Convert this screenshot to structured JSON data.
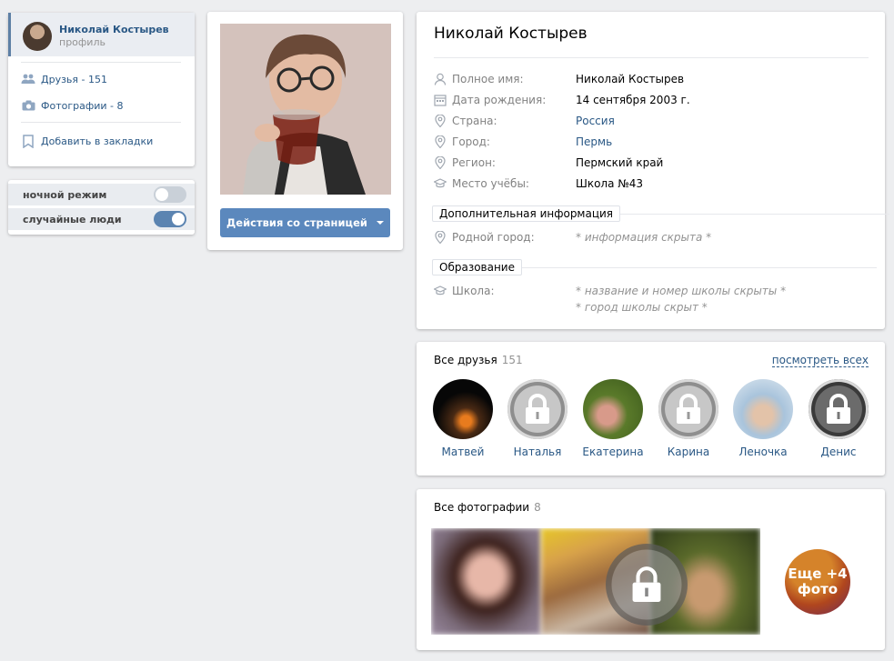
{
  "menu": {
    "profile_name": "Николай Костырев",
    "profile_sub": "профиль",
    "friends": "Друзья - 151",
    "photos": "Фотографии - 8",
    "bookmark": "Добавить в закладки"
  },
  "toggles": {
    "night_mode": {
      "label": "ночной режим",
      "on": false
    },
    "random_people": {
      "label": "случайные люди",
      "on": true
    }
  },
  "actions_button": "Действия со страницей",
  "profile": {
    "name": "Николай Костырев",
    "rows": [
      {
        "icon": "user-icon",
        "label": "Полное имя:",
        "value": "Николай Костырев"
      },
      {
        "icon": "calendar-icon",
        "label": "Дата рождения:",
        "value": "14 сентября 2003 г."
      },
      {
        "icon": "location-pin-icon",
        "label": "Страна:",
        "value": "Россия"
      },
      {
        "icon": "location-pin-icon",
        "label": "Город:",
        "value": "Пермь"
      },
      {
        "icon": "location-pin-icon",
        "label": "Регион:",
        "value": "Пермский край"
      },
      {
        "icon": "graduation-cap-icon",
        "label": "Место учёбы:",
        "value": "Школа №43"
      }
    ],
    "additional": {
      "header": "Дополнительная информация",
      "hometown_label": "Родной город:",
      "hometown_value": "* информация скрыта *"
    },
    "education": {
      "header": "Образование",
      "school_label": "Школа:",
      "school_hidden_1": "* название и номер школы скрыты *",
      "school_hidden_2": "* город школы скрыт *"
    }
  },
  "friends": {
    "title": "Все друзья",
    "count": "151",
    "see_all": "посмотреть всех",
    "items": [
      {
        "name": "Матвей",
        "locked": false
      },
      {
        "name": "Наталья",
        "locked": true
      },
      {
        "name": "Екатерина",
        "locked": false
      },
      {
        "name": "Карина",
        "locked": true
      },
      {
        "name": "Леночка",
        "locked": false
      },
      {
        "name": "Денис",
        "locked": true
      }
    ]
  },
  "photos": {
    "title": "Все фотографии",
    "count": "8",
    "more": "Еще +4\nфото"
  },
  "colors": {
    "link": "#2a5885",
    "button": "#5b88bd",
    "background": "#edeef0"
  }
}
